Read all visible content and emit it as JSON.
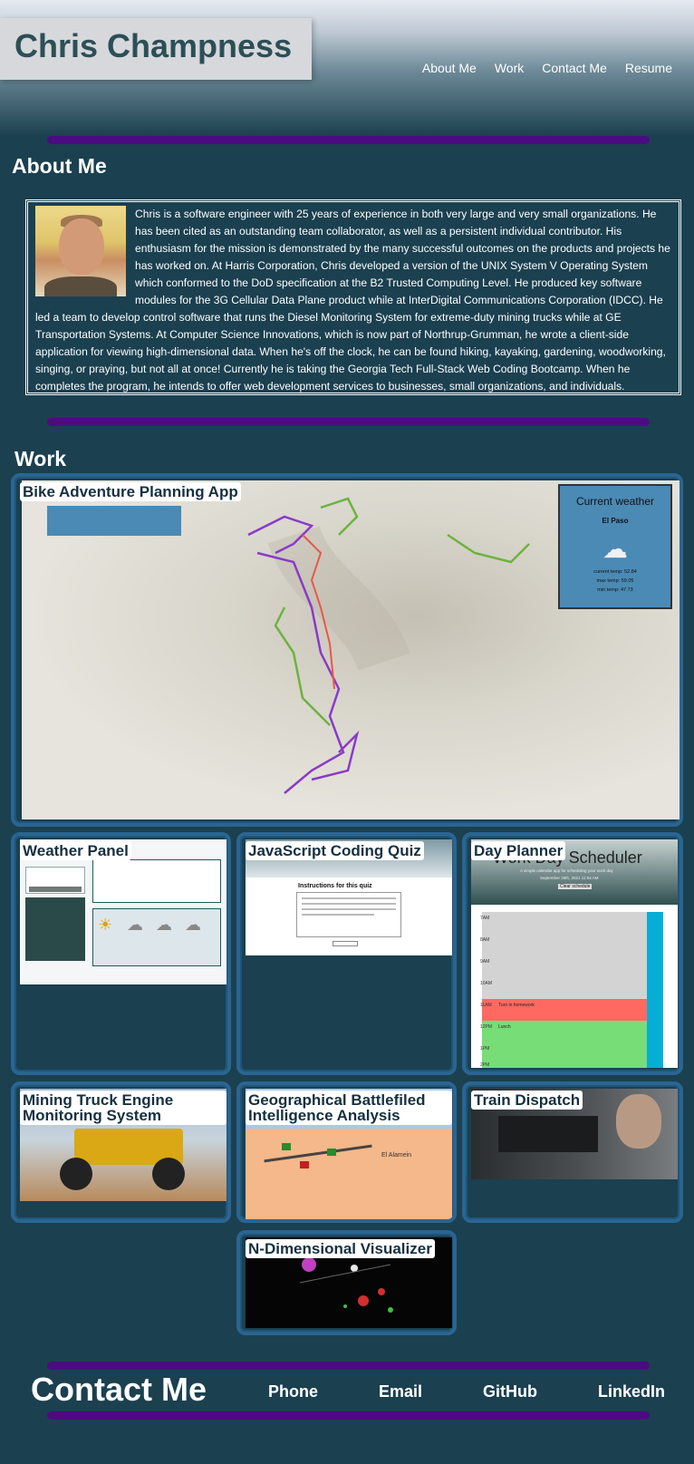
{
  "header": {
    "name": "Chris Champness",
    "nav": [
      "About Me",
      "Work",
      "Contact Me",
      "Resume"
    ]
  },
  "about": {
    "title": "About Me",
    "bio": "Chris is a software engineer with 25 years of experience in both very large and very small organizations. He has been cited as an outstanding team collaborator, as well as a persistent individual contributor. His enthusiasm for the mission is demonstrated by the many successful outcomes on the products and projects he has worked on. At Harris Corporation, Chris developed a version of the UNIX System V Operating System which conformed to the DoD specification at the B2 Trusted Computing Level. He produced key software modules for the 3G Cellular Data Plane product while at InterDigital Communications Corporation (IDCC). He led a team to develop control software that runs the Diesel Monitoring System for extreme-duty mining trucks while at GE Transportation Systems. At Computer Science Innovations, which is now part of Northrup-Grumman, he wrote a client-side application for viewing high-dimensional data. When he's off the clock, he can be found hiking, kayaking, gardening, woodworking, singing, or praying, but not all at once! Currently he is taking the Georgia Tech Full-Stack Web Coding Bootcamp. When he completes the program, he intends to offer web development services to businesses, small organizations, and individuals."
  },
  "work": {
    "title": "Work",
    "projects": [
      "Bike Adventure Planning App",
      "Weather Panel",
      "JavaScript Coding Quiz",
      "Day Planner",
      "Mining Truck Engine Monitoring System",
      "Geographical Battlefiled Intelligence Analysis",
      "Train Dispatch",
      "N-Dimensional Visualizer"
    ],
    "bike_weather": {
      "title": "Current weather",
      "city": "El Paso",
      "current": "current temp: 52.84",
      "max": "max temp: 59.05",
      "min": "min temp: 47.73"
    },
    "quiz_heading": "Instructions for this quiz",
    "scheduler": {
      "title": "Work Day Scheduler",
      "subtitle": "A simple calendar app for scheduling your work day",
      "date": "September 28th, 2021 11:54 AM",
      "clear": "Clear schedule",
      "hours": [
        "7AM",
        "8AM",
        "9AM",
        "10AM",
        "11AM",
        "12PM",
        "1PM",
        "2PM"
      ],
      "entries": [
        "",
        "",
        "",
        "",
        "Turn in homework",
        "Lunch",
        "",
        ""
      ]
    },
    "battlefield_label": "El Alamein"
  },
  "contact": {
    "title": "Contact Me",
    "links": [
      "Phone",
      "Email",
      "GitHub",
      "LinkedIn"
    ]
  },
  "colors": {
    "background": "#1b4050",
    "divider": "#4b0c82",
    "card_border": "#2a6592",
    "name_text": "#2c4f56"
  }
}
